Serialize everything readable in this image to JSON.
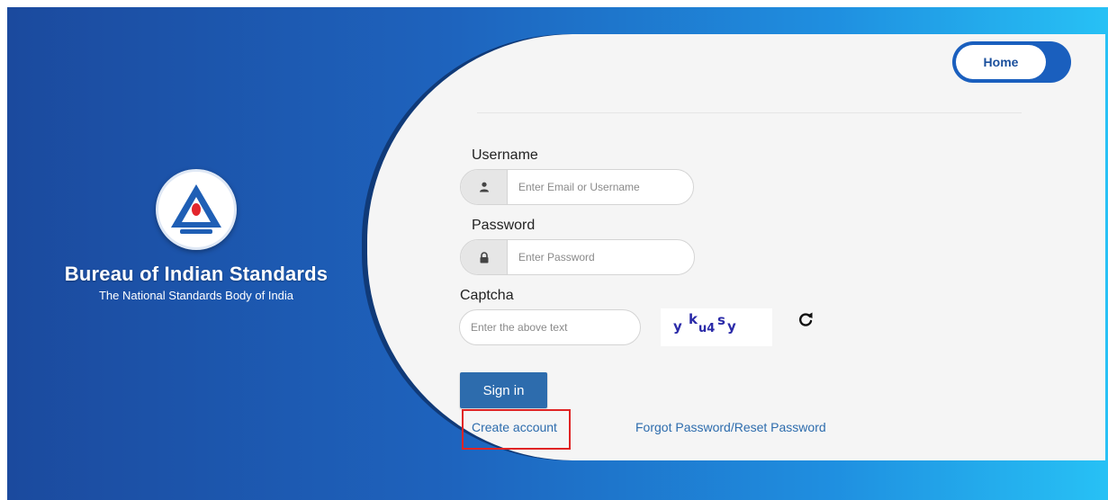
{
  "brand": {
    "title": "Bureau of Indian Standards",
    "subtitle": "The National Standards Body of India",
    "logo_icon": "bis-logo-icon"
  },
  "nav": {
    "home_label": "Home"
  },
  "form": {
    "username": {
      "label": "Username",
      "placeholder": "Enter Email or Username",
      "icon": "user-icon"
    },
    "password": {
      "label": "Password",
      "placeholder": "Enter Password",
      "icon": "lock-icon"
    },
    "captcha": {
      "label": "Captcha",
      "placeholder": "Enter the above text",
      "chars": [
        "y",
        "k",
        "u4",
        "s",
        "y"
      ],
      "refresh_icon": "refresh-icon"
    },
    "signin_label": "Sign in",
    "create_account_label": "Create account",
    "forgot_label": "Forgot Password/Reset Password"
  },
  "colors": {
    "primary": "#2d6cad",
    "gradient_start": "#1b4a9e",
    "gradient_end": "#27c1f5",
    "highlight": "#e02424"
  }
}
